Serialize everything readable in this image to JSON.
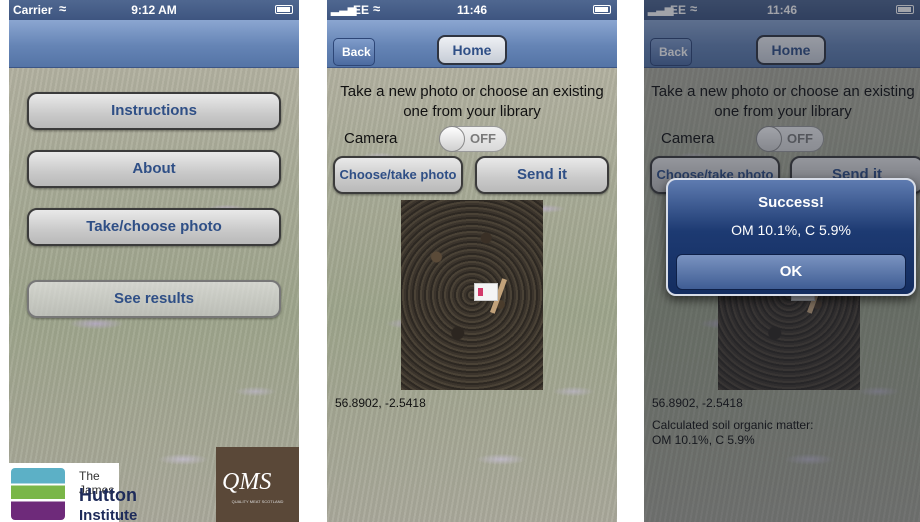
{
  "screen1": {
    "status": {
      "carrier": "Carrier",
      "wifi_icon": "wifi-icon",
      "time": "9:12 AM",
      "battery_icon": "battery-icon"
    },
    "buttons": [
      "Instructions",
      "About",
      "Take/choose photo",
      "See results"
    ],
    "logos": {
      "hutton_line1": "The James",
      "hutton_line2": "Hutton",
      "hutton_line3": "Institute",
      "qms": "QMS",
      "qms_sub": "QUALITY MEAT SCOTLAND"
    }
  },
  "screen2": {
    "status": {
      "carrier": "EE",
      "time": "11:46"
    },
    "nav": {
      "back": "Back",
      "home": "Home"
    },
    "prompt": "Take a new photo or choose an existing one from your library",
    "camera_label": "Camera",
    "toggle_text": "OFF",
    "choose_button": "Choose/take photo",
    "send_button": "Send it",
    "coords": "56.8902, -2.5418"
  },
  "screen3": {
    "status": {
      "carrier": "EE",
      "time": "11:46"
    },
    "nav": {
      "back": "Back",
      "home": "Home"
    },
    "prompt": "Take a new photo or choose an existing one from your library",
    "camera_label": "Camera",
    "toggle_text": "OFF",
    "choose_button": "Choose/take photo",
    "send_button": "Send it",
    "coords": "56.8902, -2.5418",
    "calc_line1": "Calculated soil organic matter:",
    "calc_line2": "OM 10.1%, C 5.9%",
    "alert": {
      "title": "Success!",
      "message": "OM 10.1%, C 5.9%",
      "ok": "OK"
    }
  }
}
